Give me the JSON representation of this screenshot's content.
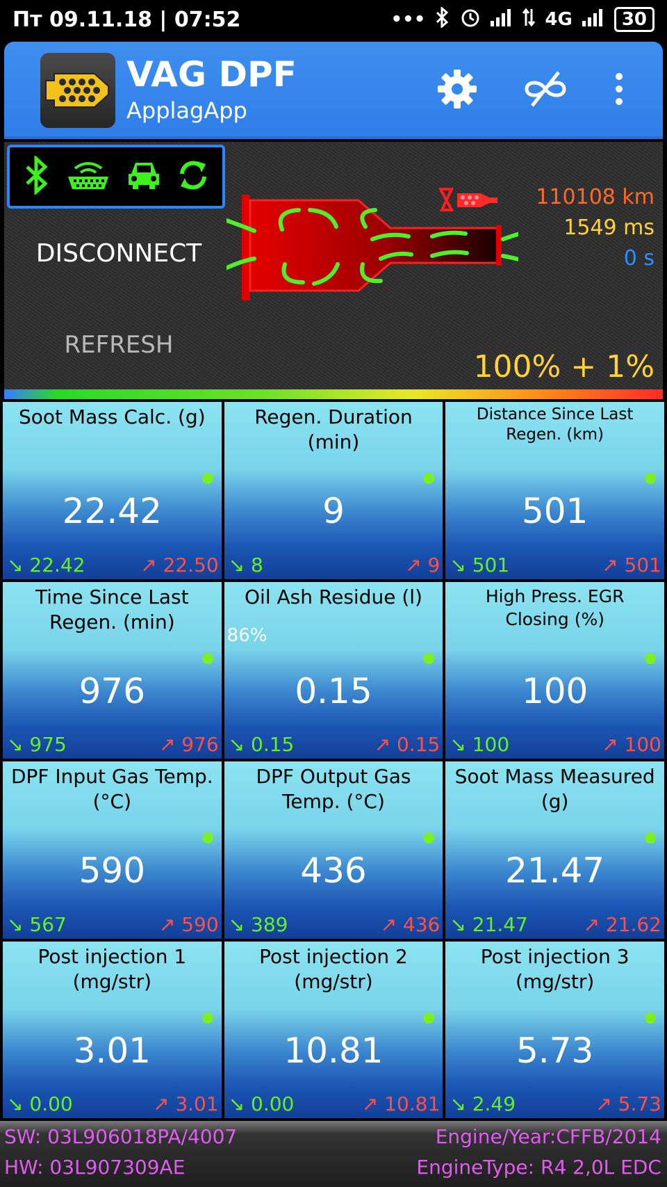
{
  "status_bar": {
    "datetime": "Пт 09.11.18 | 07:52",
    "dots": "•••",
    "network": "4G",
    "battery": "30"
  },
  "app": {
    "title": "VAG DPF",
    "subtitle": "ApplagApp",
    "icons": [
      "dpf-logo-icon",
      "gear-icon",
      "no-infinity-icon",
      "overflow-menu-icon"
    ]
  },
  "dashboard": {
    "status_icons": [
      "bluetooth-icon",
      "obd-adapter-icon",
      "car-icon",
      "sync-icon"
    ],
    "disconnect_label": "DISCONNECT",
    "refresh_label": "REFRESH",
    "odometer": "110108 km",
    "response_time": "1549 ms",
    "timer": "0 s",
    "soot_percent": "100% + 1%",
    "colors": {
      "accent": "#2f7ee8",
      "km": "#ff6a2a",
      "ms": "#ffd23a",
      "s": "#2d8fff"
    }
  },
  "tiles": [
    {
      "title": "Soot Mass Calc. (g)",
      "value": "22.42",
      "min": "22.42",
      "max": "22.50"
    },
    {
      "title": "Regen. Duration (min)",
      "value": "9",
      "min": "8",
      "max": "9"
    },
    {
      "title": "Distance Since Last Regen. (km)",
      "value": "501",
      "min": "501",
      "max": "501"
    },
    {
      "title": "Time Since Last Regen. (min)",
      "value": "976",
      "min": "975",
      "max": "976"
    },
    {
      "title": "Oil Ash Residue (l)",
      "value": "0.15",
      "min": "0.15",
      "max": "0.15",
      "percent": "86%"
    },
    {
      "title": "High Press. EGR Closing (%)",
      "value": "100",
      "min": "100",
      "max": "100"
    },
    {
      "title": "DPF Input Gas Temp. (°C)",
      "value": "590",
      "min": "567",
      "max": "590"
    },
    {
      "title": "DPF Output Gas Temp. (°C)",
      "value": "436",
      "min": "389",
      "max": "436"
    },
    {
      "title": "Soot Mass Measured (g)",
      "value": "21.47",
      "min": "21.47",
      "max": "21.62"
    },
    {
      "title": "Post injection 1 (mg/str)",
      "value": "3.01",
      "min": "0.00",
      "max": "3.01"
    },
    {
      "title": "Post injection 2 (mg/str)",
      "value": "10.81",
      "min": "0.00",
      "max": "10.81"
    },
    {
      "title": "Post injection 3 (mg/str)",
      "value": "5.73",
      "min": "2.49",
      "max": "5.73"
    }
  ],
  "footer": {
    "sw": "SW: 03L906018PA/4007",
    "hw": "HW: 03L907309AE",
    "engine_year": "Engine/Year:CFFB/2014",
    "engine_type": "EngineType: R4 2,0L EDC"
  }
}
